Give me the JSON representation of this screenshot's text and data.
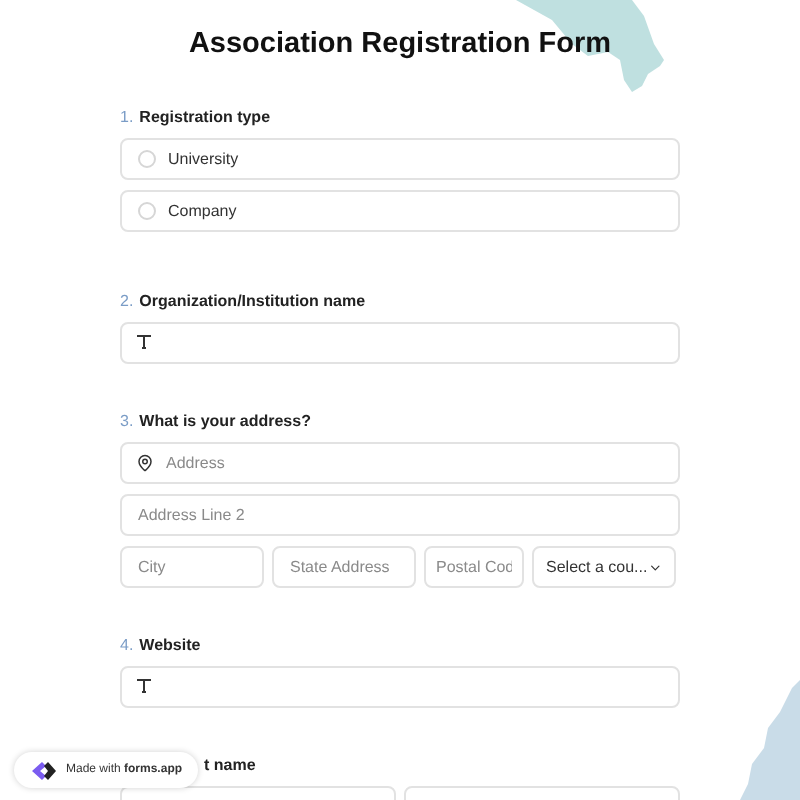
{
  "title": "Association Registration Form",
  "questions": [
    {
      "number": "1.",
      "label": "Registration type",
      "kind": "radio",
      "options": [
        {
          "label": "University",
          "selected": false
        },
        {
          "label": "Company",
          "selected": false
        }
      ]
    },
    {
      "number": "2.",
      "label": "Organization/Institution name",
      "kind": "text"
    },
    {
      "number": "3.",
      "label": "What is your address?",
      "kind": "address",
      "address": {
        "placeholder": "Address"
      },
      "line2": {
        "placeholder": "Address Line 2"
      },
      "city": {
        "placeholder": "City"
      },
      "state": {
        "placeholder": "State Address"
      },
      "postal": {
        "placeholder": "Postal Cod"
      },
      "country": "Select a cou..."
    },
    {
      "number": "4.",
      "label": "Website",
      "kind": "text"
    },
    {
      "label": "t name",
      "kind": "pair"
    }
  ],
  "badge": {
    "prefix": "Made with ",
    "brand": "forms.app"
  }
}
